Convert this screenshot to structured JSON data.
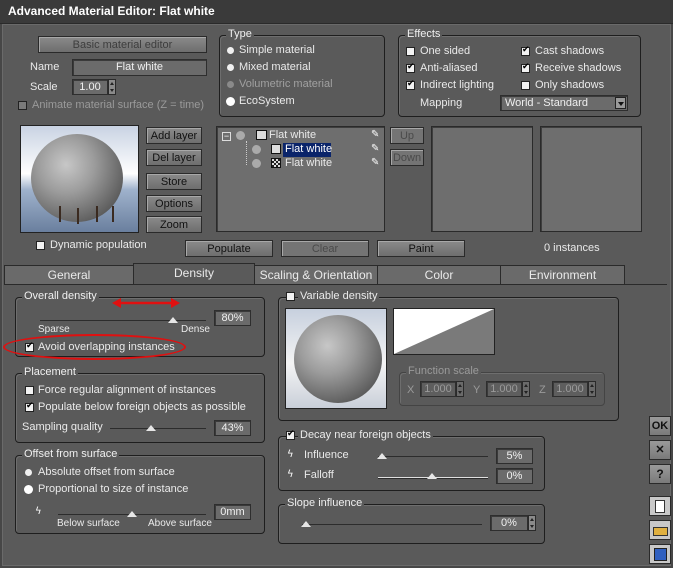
{
  "window": {
    "title": "Advanced Material Editor: Flat white"
  },
  "top": {
    "basic_editor": "Basic material editor",
    "name_label": "Name",
    "name_value": "Flat white",
    "scale_label": "Scale",
    "scale_value": "1.00",
    "animate_label": "Animate material surface (Z = time)"
  },
  "type": {
    "title": "Type",
    "options": [
      "Simple material",
      "Mixed material",
      "Volumetric material",
      "EcoSystem"
    ],
    "selected": "EcoSystem"
  },
  "effects": {
    "title": "Effects",
    "one_sided": "One sided",
    "anti_aliased": "Anti-aliased",
    "indirect_lighting": "Indirect lighting",
    "cast_shadows": "Cast shadows",
    "receive_shadows": "Receive shadows",
    "only_shadows": "Only shadows",
    "mapping_label": "Mapping",
    "mapping_value": "World - Standard"
  },
  "layers": {
    "add": "Add layer",
    "del": "Del layer",
    "store": "Store",
    "options": "Options",
    "zoom": "Zoom",
    "up": "Up",
    "down": "Down",
    "tree": [
      "Flat white",
      "Flat white",
      "Flat white"
    ],
    "dynamic_population": "Dynamic population",
    "populate": "Populate",
    "clear": "Clear",
    "paint": "Paint",
    "instances": "0 instances"
  },
  "tabs": [
    "General",
    "Density",
    "Scaling & Orientation",
    "Color",
    "Environment"
  ],
  "active_tab": "Density",
  "density": {
    "overall_title": "Overall density",
    "overall_value": "80%",
    "overall_level": 0.8,
    "sparse": "Sparse",
    "dense": "Dense",
    "avoid_overlap": "Avoid overlapping instances",
    "placement_title": "Placement",
    "force_regular": "Force regular alignment of instances",
    "populate_below": "Populate below foreign objects as possible",
    "sampling_label": "Sampling quality",
    "sampling_value": "43%",
    "sampling_level": 0.43,
    "offset_title": "Offset from surface",
    "absolute_offset": "Absolute offset from surface",
    "proportional": "Proportional to size of instance",
    "below_surface": "Below surface",
    "above_surface": "Above surface",
    "offset_value": "0mm",
    "variable_density": "Variable density",
    "function_scale": "Function scale",
    "fx_label": "X",
    "fx": "1.000",
    "fy_label": "Y",
    "fy": "1.000",
    "fz_label": "Z",
    "fz": "1.000",
    "decay_title": "Decay near foreign objects",
    "influence_label": "Influence",
    "influence_value": "5%",
    "falloff_label": "Falloff",
    "falloff_value": "0%",
    "slope_title": "Slope influence",
    "slope_value": "0%"
  },
  "side": {
    "ok": "OK",
    "close": "✕",
    "help": "?"
  },
  "colors": {
    "background": "#5a5a5a",
    "selection": "#0a246a",
    "annotation": "#e01010"
  }
}
